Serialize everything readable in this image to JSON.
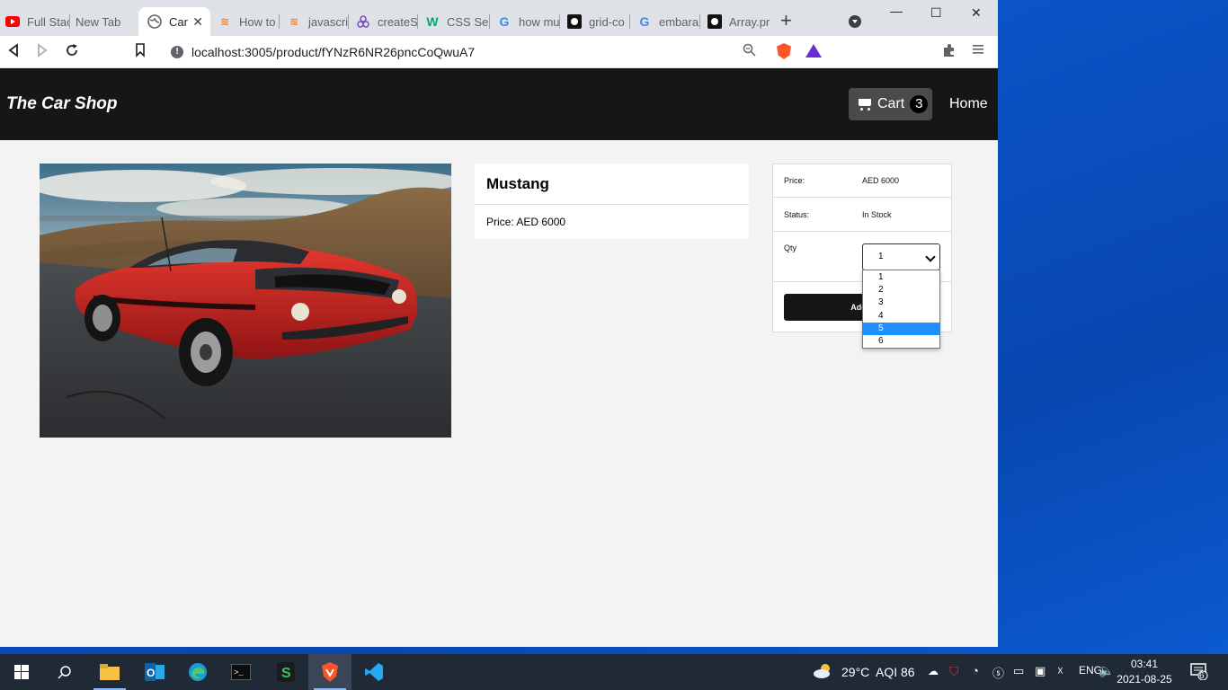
{
  "browser": {
    "tabs": [
      {
        "label": "Full Stac",
        "icon": "youtube-icon",
        "color": "#ff0000"
      },
      {
        "label": "New Tab",
        "icon": "none"
      },
      {
        "label": "Car",
        "icon": "globe-icon",
        "active": true
      },
      {
        "label": "How to",
        "icon": "stackoverflow-icon",
        "color": "#f48024"
      },
      {
        "label": "javascrip",
        "icon": "stackoverflow-icon",
        "color": "#f48024"
      },
      {
        "label": "createSl",
        "icon": "redux-icon",
        "color": "#764abc"
      },
      {
        "label": "CSS Sel",
        "icon": "w3schools-icon",
        "color": "#04aa6d"
      },
      {
        "label": "how mu",
        "icon": "google-icon",
        "color": "#4285f4"
      },
      {
        "label": "grid-co",
        "icon": "github-icon",
        "color": "#000000"
      },
      {
        "label": "embara",
        "icon": "google-icon",
        "color": "#4285f4"
      },
      {
        "label": "Array.pr",
        "icon": "mdn-icon",
        "color": "#000000"
      }
    ],
    "url": "localhost:3005/product/fYNzR6NR26pncCoQwuA7"
  },
  "navbar": {
    "brand": "The Car Shop",
    "cart_label": "Cart",
    "cart_count": "3",
    "home_label": "Home"
  },
  "product": {
    "name": "Mustang",
    "price_text": "Price: AED 6000",
    "image_alt": "Red Ford Mustang"
  },
  "buy_box": {
    "price_label": "Price:",
    "price_value": "AED 6000",
    "status_label": "Status:",
    "status_value": "In Stock",
    "qty_label": "Qty",
    "qty_selected": "1",
    "qty_options": [
      "1",
      "2",
      "3",
      "4",
      "5",
      "6"
    ],
    "qty_highlighted": "5",
    "add_button": "Add To Cart",
    "add_button_visible": "Add T"
  },
  "taskbar": {
    "weather_temp": "29°C",
    "aqi": "AQI 86",
    "time": "03:41",
    "date": "2021-08-25",
    "notification_count": "6"
  },
  "colors": {
    "navbar_bg": "#161616",
    "page_bg": "#f3f3f3",
    "highlight": "#1e90ff"
  }
}
